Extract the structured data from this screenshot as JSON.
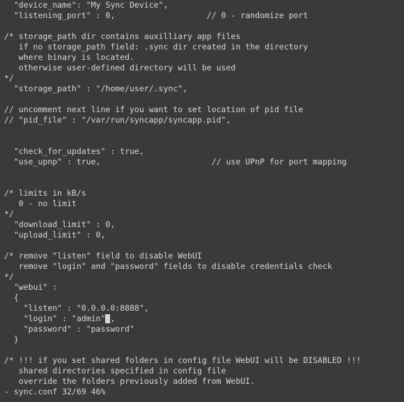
{
  "config_text": {
    "l01": "  \"device_name\": \"My Sync Device\",",
    "l02": "  \"listening_port\" : 0,                   // 0 - randomize port",
    "l03": "",
    "l04": "/* storage_path dir contains auxilliary app files",
    "l05": "   if no storage_path field: .sync dir created in the directory",
    "l06": "   where binary is located.",
    "l07": "   otherwise user-defined directory will be used",
    "l08": "*/",
    "l09": "  \"storage_path\" : \"/home/user/.sync\",",
    "l10": "",
    "l11": "// uncomment next line if you want to set location of pid file",
    "l12": "// \"pid_file\" : \"/var/run/syncapp/syncapp.pid\",",
    "l13": "",
    "l14": "",
    "l15": "  \"check_for_updates\" : true,",
    "l16": "  \"use_upnp\" : true,                       // use UPnP for port mapping",
    "l17": "",
    "l18": "",
    "l19": "/* limits in kB/s",
    "l20": "   0 - no limit",
    "l21": "*/",
    "l22": "  \"download_limit\" : 0,",
    "l23": "  \"upload_limit\" : 0,",
    "l24": "",
    "l25": "/* remove \"listen\" field to disable WebUI",
    "l26": "   remove \"login\" and \"password\" fields to disable credentials check",
    "l27": "*/",
    "l28": "  \"webui\" :",
    "l29": "  {",
    "l30": "    \"listen\" : \"0.0.0.0:8888\",",
    "l31a": "    \"login\" : \"admin\"",
    "l31b": ",",
    "l32": "    \"password\" : \"password\"",
    "l33": "  }",
    "l34": "",
    "l35": "/* !!! if you set shared folders in config file WebUI will be DISABLED !!!",
    "l36": "   shared directories specified in config file",
    "l37": "   override the folders previously added from WebUI."
  },
  "status": {
    "text": "- sync.conf 32/69 46%"
  }
}
